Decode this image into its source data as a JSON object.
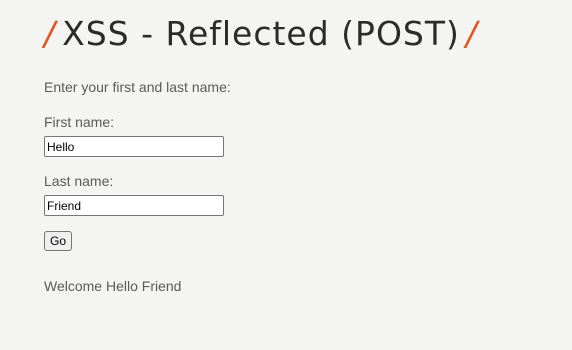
{
  "header": {
    "slash_left": "/",
    "title": "XSS - Reflected (POST)",
    "slash_right": "/"
  },
  "form": {
    "intro": "Enter your first and last name:",
    "first_name_label": "First name:",
    "first_name_value": "Hello",
    "last_name_label": "Last name:",
    "last_name_value": "Friend",
    "submit_label": "Go"
  },
  "result": {
    "message": "Welcome Hello Friend"
  },
  "colors": {
    "accent": "#e4541d",
    "background": "#f4f4f3",
    "text": "#5a5a5a"
  }
}
